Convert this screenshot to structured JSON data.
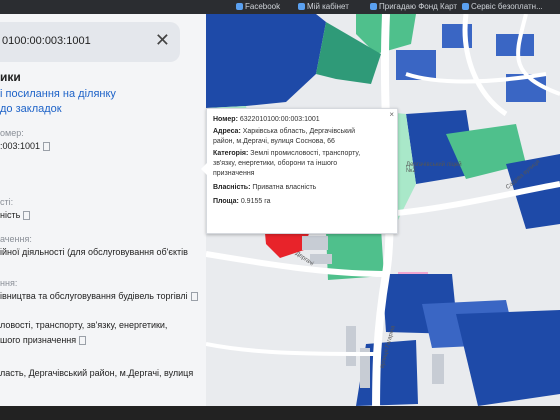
{
  "bookmarks": [
    "Facebook",
    "Мій кабінет",
    "Пригадаю Фонд Карт",
    "Сервіс безоплатн..."
  ],
  "search": {
    "value": "0100:00:003:1001"
  },
  "sidebar": {
    "heading": "ики",
    "links": [
      "і посилання на ділянку",
      "до закладок"
    ],
    "number_label": "омер:",
    "number_value": ":003:1001",
    "ownership_label": "сті:",
    "ownership_value": "ність",
    "purpose_label": "ачення:",
    "purpose_value": "ійної діяльності (для обслуговування об'єктів",
    "category_label": "ння:",
    "category_value": "івництва та обслуговування будівель торгівлі",
    "category_full_1": "ловості, транспорту, зв'язку, енергетики,",
    "category_full_2": "шого призначення",
    "address_value": "ласть, Дергачівський район, м.Дергачі, вулиця"
  },
  "popup": {
    "number_label": "Номер:",
    "number_value": "6322010100:00:003:1001",
    "address_label": "Адреса:",
    "address_line1": "Харківська область, Дергачівський",
    "address_line2": "район, м.Дергачі, вулиця Соснова, 66",
    "category_label": "Категорія:",
    "category_line1": "Землі промисловості, транспорту,",
    "category_line2": "зв'язку, енергетики, оборони та іншого",
    "category_line3": "призначення",
    "ownership_label": "Власність:",
    "ownership_value": "Приватна власність",
    "area_label": "Площа:",
    "area_value": "0.9155 га",
    "close": "×"
  },
  "map_labels": {
    "street1": "Дергачі",
    "street2": "вулиця Гагаріна",
    "district": "Дергачівський ліцей №2",
    "street3": "Садова вулиця"
  },
  "colors": {
    "parcel_highlight": "#e8232a",
    "zone_blue": "#1e4aa8",
    "zone_green": "#4fc08c",
    "zone_light_green": "#a9e8c9",
    "link": "#1e63c8"
  }
}
